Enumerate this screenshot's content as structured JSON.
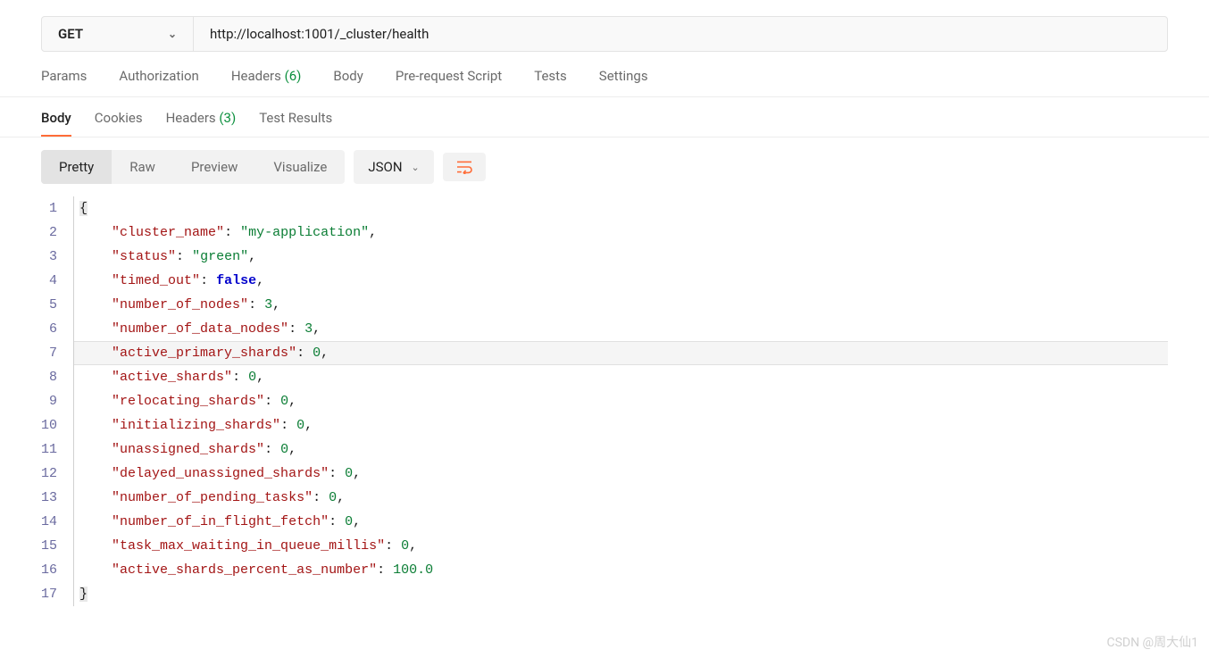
{
  "request": {
    "method": "GET",
    "url": "http://localhost:1001/_cluster/health"
  },
  "request_tabs": [
    {
      "label": "Params"
    },
    {
      "label": "Authorization"
    },
    {
      "label": "Headers",
      "count": "(6)"
    },
    {
      "label": "Body"
    },
    {
      "label": "Pre-request Script"
    },
    {
      "label": "Tests"
    },
    {
      "label": "Settings"
    }
  ],
  "response_tabs": [
    {
      "label": "Body",
      "active": true
    },
    {
      "label": "Cookies"
    },
    {
      "label": "Headers",
      "count": "(3)"
    },
    {
      "label": "Test Results"
    }
  ],
  "view_modes": [
    {
      "label": "Pretty",
      "active": true
    },
    {
      "label": "Raw"
    },
    {
      "label": "Preview"
    },
    {
      "label": "Visualize"
    }
  ],
  "format": "JSON",
  "response_body": {
    "cluster_name": "my-application",
    "status": "green",
    "timed_out": false,
    "number_of_nodes": 3,
    "number_of_data_nodes": 3,
    "active_primary_shards": 0,
    "active_shards": 0,
    "relocating_shards": 0,
    "initializing_shards": 0,
    "unassigned_shards": 0,
    "delayed_unassigned_shards": 0,
    "number_of_pending_tasks": 0,
    "number_of_in_flight_fetch": 0,
    "task_max_waiting_in_queue_millis": 0,
    "active_shards_percent_as_number": 100.0
  },
  "highlighted_line": 7,
  "watermark": "CSDN @周大仙1"
}
